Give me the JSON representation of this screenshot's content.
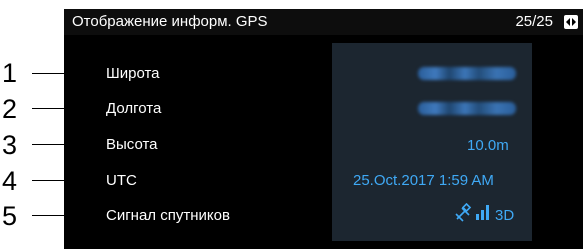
{
  "header": {
    "title": "Отображение информ. GPS",
    "page_indicator": "25/25"
  },
  "rows": [
    {
      "label": "Широта",
      "value": ""
    },
    {
      "label": "Долгота",
      "value": ""
    },
    {
      "label": "Высота",
      "value": "10.0m"
    },
    {
      "label": "UTC",
      "value": "25.Oct.2017 1:59 AM"
    },
    {
      "label": "Сигнал спутников",
      "value": "3D"
    }
  ],
  "callouts": [
    "1",
    "2",
    "3",
    "4",
    "5"
  ],
  "colors": {
    "background": "#000000",
    "value_text": "#3fa9f5",
    "label_text": "#ffffff",
    "panel": "#1c2630"
  },
  "icons": {
    "nav": "page-nav-icon",
    "satellite": "satellite-icon",
    "signal": "signal-bars-icon"
  }
}
